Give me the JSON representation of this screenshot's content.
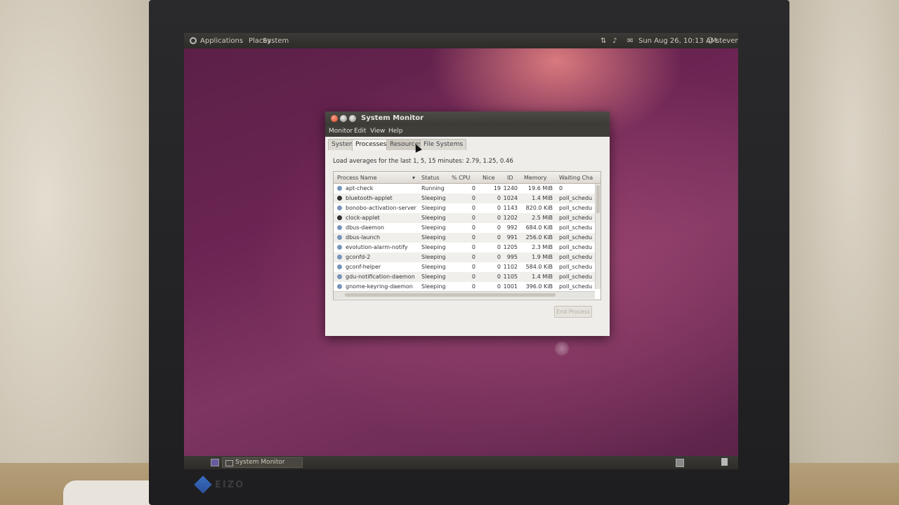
{
  "top_panel": {
    "menus": [
      "Applications",
      "Places",
      "System"
    ],
    "datetime": "Sun Aug 26, 10:13 AM",
    "user": "steven"
  },
  "window": {
    "title": "System Monitor",
    "menubar": [
      "Monitor",
      "Edit",
      "View",
      "Help"
    ],
    "tabs": [
      "System",
      "Processes",
      "Resources",
      "File Systems"
    ],
    "active_tab": "Processes",
    "load_averages": "Load averages for the last 1, 5, 15 minutes: 2.79, 1.25, 0.46",
    "columns": [
      "Process Name",
      "Status",
      "% CPU",
      "Nice",
      "ID",
      "Memory",
      "Waiting Cha"
    ],
    "rows": [
      {
        "name": "apt-check",
        "status": "Running",
        "cpu": "0",
        "nice": "19",
        "id": "1240",
        "memory": "19.6 MiB",
        "wait": "0"
      },
      {
        "name": "bluetooth-applet",
        "status": "Sleeping",
        "cpu": "0",
        "nice": "0",
        "id": "1024",
        "memory": "1.4 MiB",
        "wait": "poll_schedu"
      },
      {
        "name": "bonobo-activation-server",
        "status": "Sleeping",
        "cpu": "0",
        "nice": "0",
        "id": "1143",
        "memory": "820.0 KiB",
        "wait": "poll_schedu"
      },
      {
        "name": "clock-applet",
        "status": "Sleeping",
        "cpu": "0",
        "nice": "0",
        "id": "1202",
        "memory": "2.5 MiB",
        "wait": "poll_schedu"
      },
      {
        "name": "dbus-daemon",
        "status": "Sleeping",
        "cpu": "0",
        "nice": "0",
        "id": "992",
        "memory": "684.0 KiB",
        "wait": "poll_schedu"
      },
      {
        "name": "dbus-launch",
        "status": "Sleeping",
        "cpu": "0",
        "nice": "0",
        "id": "991",
        "memory": "256.0 KiB",
        "wait": "poll_schedu"
      },
      {
        "name": "evolution-alarm-notify",
        "status": "Sleeping",
        "cpu": "0",
        "nice": "0",
        "id": "1205",
        "memory": "2.3 MiB",
        "wait": "poll_schedu"
      },
      {
        "name": "gconfd-2",
        "status": "Sleeping",
        "cpu": "0",
        "nice": "0",
        "id": "995",
        "memory": "1.9 MiB",
        "wait": "poll_schedu"
      },
      {
        "name": "gconf-helper",
        "status": "Sleeping",
        "cpu": "0",
        "nice": "0",
        "id": "1102",
        "memory": "584.0 KiB",
        "wait": "poll_schedu"
      },
      {
        "name": "gdu-notification-daemon",
        "status": "Sleeping",
        "cpu": "0",
        "nice": "0",
        "id": "1105",
        "memory": "1.4 MiB",
        "wait": "poll_schedu"
      },
      {
        "name": "gnome-keyring-daemon",
        "status": "Sleeping",
        "cpu": "0",
        "nice": "0",
        "id": "1001",
        "memory": "396.0 KiB",
        "wait": "poll_schedu"
      }
    ],
    "end_process_button": "End Process"
  },
  "bottom_panel": {
    "taskbar_item": "System Monitor"
  },
  "monitor": {
    "brand": "EIZO"
  }
}
